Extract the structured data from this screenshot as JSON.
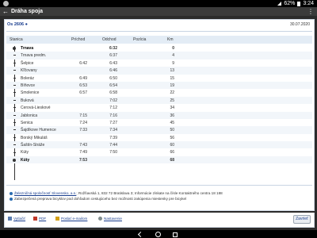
{
  "status_bar": {
    "battery": "62%",
    "time": "3:24"
  },
  "nav": {
    "title": "Dráha spoja"
  },
  "train": {
    "name": "Os 2606",
    "date": "30.07.2020"
  },
  "table": {
    "headers": {
      "station": "Stanica",
      "arrival": "Príchod",
      "departure": "Odchod",
      "position": "Pozícia",
      "km": "Km"
    },
    "rows": [
      {
        "station": "Trnava",
        "arrival": "",
        "departure": "6:32",
        "km": "0",
        "bold": true
      },
      {
        "station": "Trnava predm.",
        "arrival": "",
        "departure": "6:37",
        "km": "4"
      },
      {
        "station": "Šelpice",
        "arrival": "6:42",
        "departure": "6:43",
        "km": "9"
      },
      {
        "station": "Kľčovany",
        "arrival": "",
        "departure": "6:46",
        "km": "13"
      },
      {
        "station": "Boleráz",
        "arrival": "6:49",
        "departure": "6:50",
        "km": "15"
      },
      {
        "station": "Bíňovce",
        "arrival": "6:53",
        "departure": "6:54",
        "km": "19"
      },
      {
        "station": "Smolenice",
        "arrival": "6:57",
        "departure": "6:58",
        "km": "22"
      },
      {
        "station": "Buková",
        "arrival": "",
        "departure": "7:02",
        "km": "25"
      },
      {
        "station": "Cerová-Lieskové",
        "arrival": "",
        "departure": "7:12",
        "km": "34"
      },
      {
        "station": "Jablonica",
        "arrival": "7:15",
        "departure": "7:16",
        "km": "36"
      },
      {
        "station": "Senica",
        "arrival": "7:24",
        "departure": "7:27",
        "km": "45"
      },
      {
        "station": "Šajdíkove Humence",
        "arrival": "7:33",
        "departure": "7:34",
        "km": "50"
      },
      {
        "station": "Borský Mikuláš",
        "arrival": "",
        "departure": "7:39",
        "km": "56"
      },
      {
        "station": "Šaštín-Stráže",
        "arrival": "7:43",
        "departure": "7:44",
        "km": "60"
      },
      {
        "station": "Kúty",
        "arrival": "7:49",
        "departure": "7:50",
        "km": "66"
      },
      {
        "station": "Kúty",
        "arrival": "7:53",
        "departure": "",
        "km": "68",
        "bold": true
      }
    ]
  },
  "info": {
    "company_link": "Železničná spoločnosť Slovensko, a.s.",
    "company_text": "; Rožňavská 1, 832 72 Bratislava 3; Informácie získate na čísle Kontaktného centra 18 188",
    "bike_text": "Zabezpečená preprava bicyklov pod dohľadom cestujúceho bez možnosti zakúpenia miestenky pre bicykel"
  },
  "footer": {
    "print": "Vytlačiť",
    "pdf": "PDF",
    "email": "Poslať e-mailom",
    "settings": "Nastavenie",
    "close": "Zavrieť"
  },
  "colors": {
    "accent": "#1b3f8f",
    "header_bg": "#e3ecf5"
  }
}
